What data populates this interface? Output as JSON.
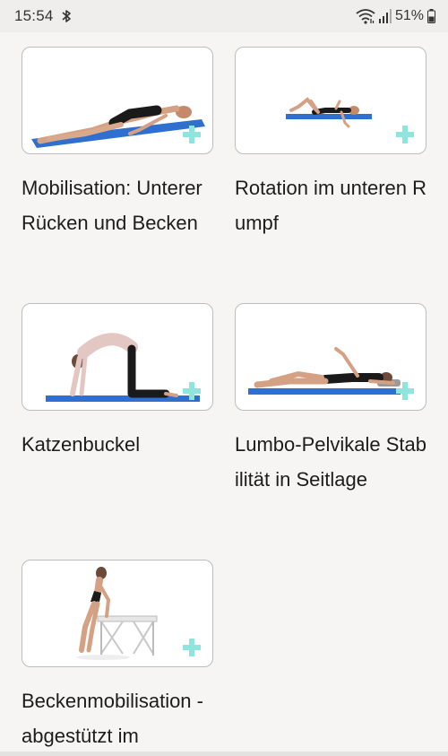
{
  "status_bar": {
    "time": "15:54",
    "battery": "51%"
  },
  "exercises": [
    {
      "title": "Mobilisation: Unterer Rücken und Becken",
      "thumbnail_icon": "supine-lying-figure"
    },
    {
      "title": "Rotation im unteren Rumpf",
      "thumbnail_icon": "supine-rotation-figure"
    },
    {
      "title": "Katzenbuckel",
      "thumbnail_icon": "cat-cow-figure"
    },
    {
      "title": "Lumbo-Pelvikale Stabilität in Seitlage",
      "thumbnail_icon": "side-lying-figure"
    },
    {
      "title": "Beckenmobilisation -abgestützt im",
      "thumbnail_icon": "standing-table-figure"
    }
  ],
  "colors": {
    "background": "#f6f5f3",
    "mat_blue": "#2f6fd0",
    "add_icon": "#8ee5dd"
  },
  "add_icon": "plus-icon"
}
